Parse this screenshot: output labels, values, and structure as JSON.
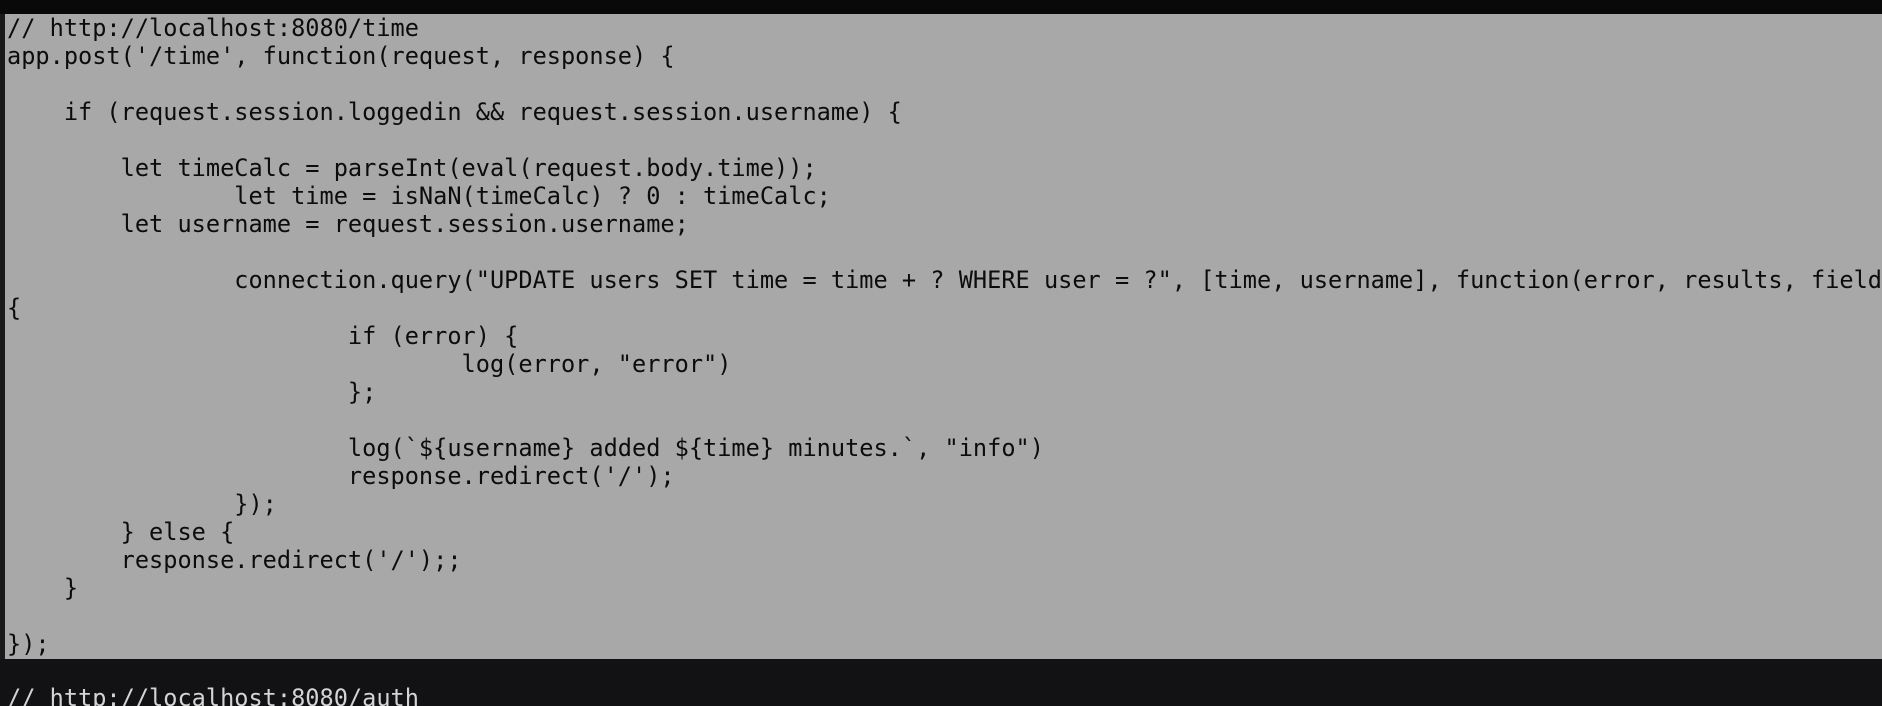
{
  "editor": {
    "selected_lines": [
      "// http://localhost:8080/time",
      "app.post('/time', function(request, response) {",
      "",
      "    if (request.session.loggedin && request.session.username) {",
      "",
      "        let timeCalc = parseInt(eval(request.body.time));",
      "                let time = isNaN(timeCalc) ? 0 : timeCalc;",
      "        let username = request.session.username;",
      "",
      "                connection.query(\"UPDATE users SET time = time + ? WHERE user = ?\", [time, username], function(error, results, fields)",
      "{",
      "                        if (error) {",
      "                                log(error, \"error\")",
      "                        };",
      "",
      "                        log(`${username} added ${time} minutes.`, \"info\")",
      "                        response.redirect('/');",
      "                });",
      "        } else {",
      "        response.redirect('/');;",
      "    }",
      "",
      "});"
    ],
    "following_lines": [
      "// http://localhost:8080/auth"
    ]
  }
}
